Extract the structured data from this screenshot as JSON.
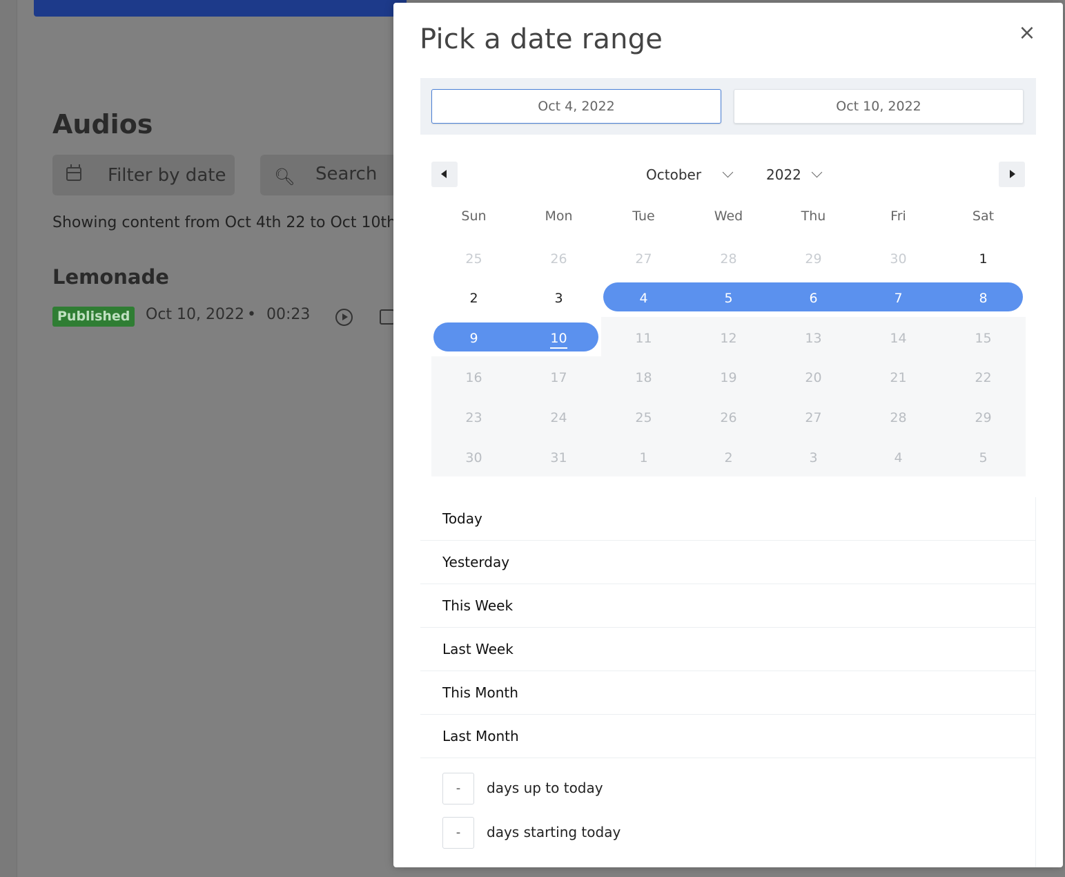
{
  "background": {
    "page_title": "Audios",
    "filter_label": "Filter by date",
    "search_placeholder": "Search",
    "showing_text": "Showing content from Oct 4th 22 to Oct 10th",
    "item": {
      "title": "Lemonade",
      "status": "Published",
      "date": "Oct 10, 2022",
      "separator": "•",
      "duration": "00:23"
    }
  },
  "modal": {
    "title": "Pick a date range",
    "close_icon": "×",
    "start_date": "Oct 4, 2022",
    "end_date": "Oct 10, 2022",
    "month": "October",
    "year": "2022",
    "weekdays": [
      "Sun",
      "Mon",
      "Tue",
      "Wed",
      "Thu",
      "Fri",
      "Sat"
    ],
    "weeks": [
      [
        "25",
        "26",
        "27",
        "28",
        "29",
        "30",
        "1"
      ],
      [
        "2",
        "3",
        "4",
        "5",
        "6",
        "7",
        "8"
      ],
      [
        "9",
        "10",
        "11",
        "12",
        "13",
        "14",
        "15"
      ],
      [
        "16",
        "17",
        "18",
        "19",
        "20",
        "21",
        "22"
      ],
      [
        "23",
        "24",
        "25",
        "26",
        "27",
        "28",
        "29"
      ],
      [
        "30",
        "31",
        "1",
        "2",
        "3",
        "4",
        "5"
      ]
    ],
    "presets": [
      "Today",
      "Yesterday",
      "This Week",
      "Last Week",
      "This Month",
      "Last Month"
    ],
    "days_up_value": "-",
    "days_up_label": "days up to today",
    "days_start_value": "-",
    "days_start_label": "days starting today",
    "accent_color": "#5b91ee"
  }
}
